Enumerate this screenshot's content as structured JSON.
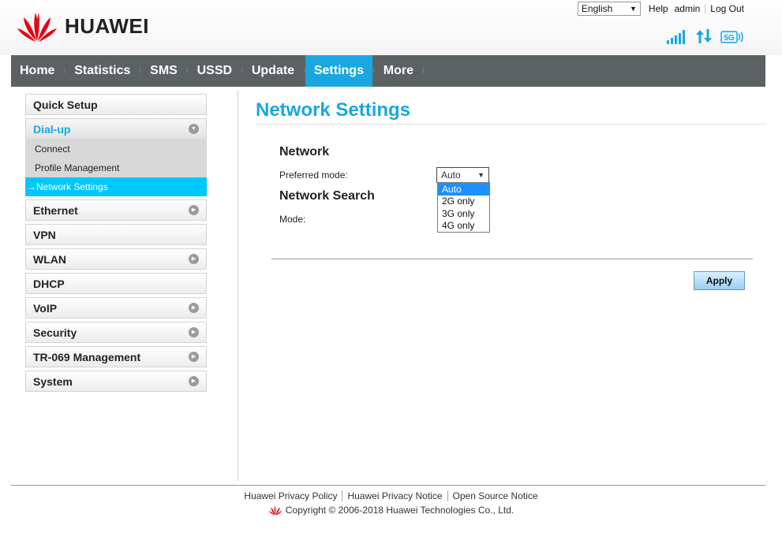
{
  "header": {
    "brand": "HUAWEI",
    "language": "English",
    "help": "Help",
    "user": "admin",
    "logout": "Log Out",
    "network_badge": "5G"
  },
  "nav": [
    {
      "label": "Home"
    },
    {
      "label": "Statistics"
    },
    {
      "label": "SMS"
    },
    {
      "label": "USSD"
    },
    {
      "label": "Update"
    },
    {
      "label": "Settings"
    },
    {
      "label": "More"
    }
  ],
  "sidebar": {
    "quick_setup": "Quick Setup",
    "dialup": "Dial-up",
    "dialup_items": [
      "Connect",
      "Profile Management",
      "Network Settings"
    ],
    "ethernet": "Ethernet",
    "vpn": "VPN",
    "wlan": "WLAN",
    "dhcp": "DHCP",
    "voip": "VoIP",
    "security": "Security",
    "tr069": "TR-069 Management",
    "system": "System"
  },
  "main": {
    "title": "Network Settings",
    "network_heading": "Network",
    "preferred_mode_label": "Preferred mode:",
    "preferred_mode_value": "Auto",
    "options": [
      "Auto",
      "2G only",
      "3G only",
      "4G only"
    ],
    "search_heading": "Network Search",
    "mode_label": "Mode:",
    "apply": "Apply"
  },
  "footer": {
    "privacy_policy": "Huawei Privacy Policy",
    "privacy_notice": "Huawei Privacy Notice",
    "open_source": "Open Source Notice",
    "copyright": "Copyright © 2006-2018 Huawei Technologies Co., Ltd."
  },
  "colors": {
    "accent": "#1aa7e0",
    "nav_bg": "#5c6163",
    "highlight": "#00c8ff",
    "brand_red": "#e60012"
  }
}
